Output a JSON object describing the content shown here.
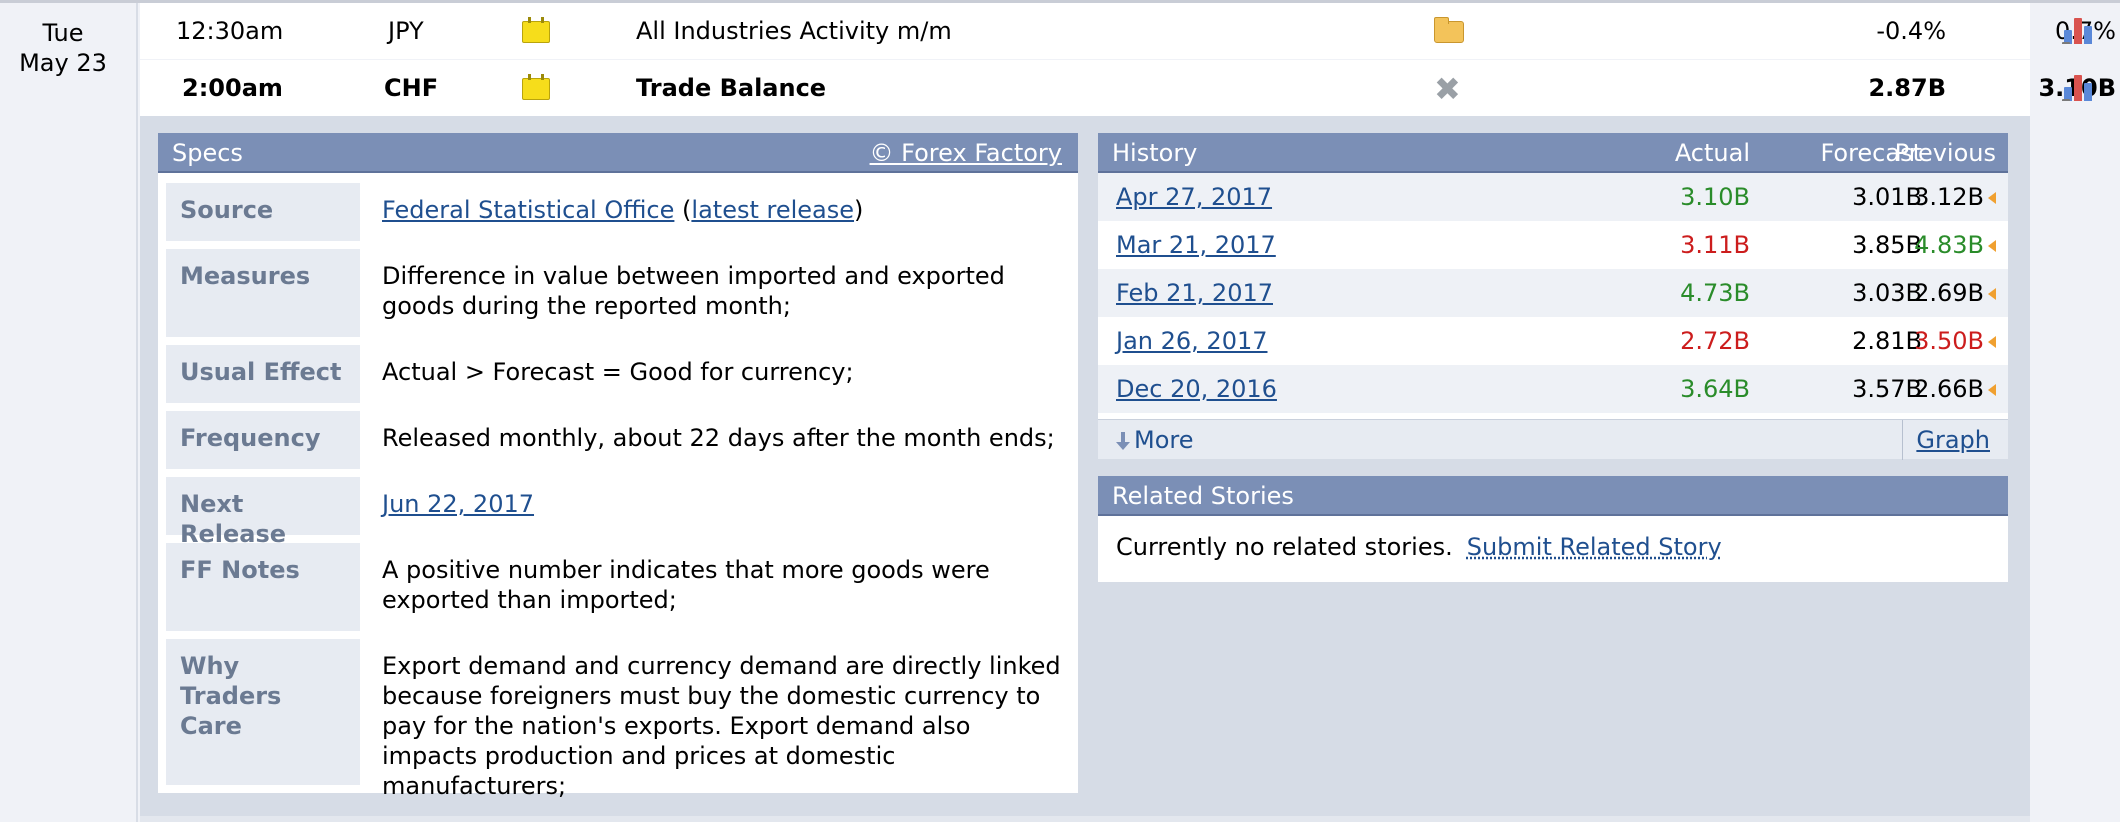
{
  "day": {
    "weekday": "Tue",
    "date": "May 23"
  },
  "events": [
    {
      "time": "12:30am",
      "currency": "JPY",
      "impact_icon": "impact-yellow-icon",
      "title": "All Industries Activity m/m",
      "detail_icon": "folder-icon",
      "actual": "-0.4%",
      "forecast": "0.7%",
      "previous": ""
    },
    {
      "time": "2:00am",
      "currency": "CHF",
      "impact_icon": "impact-yellow-icon",
      "title": "Trade Balance",
      "detail_icon": "close-icon",
      "actual": "2.87B",
      "forecast": "3.10B",
      "previous": ""
    }
  ],
  "specs": {
    "header": "Specs",
    "credit": "© Forex Factory",
    "rows": [
      {
        "label": "Source",
        "value_link": "Federal Statistical Office",
        "value_open": " (",
        "value_link2": "latest release",
        "value_close": ")"
      },
      {
        "label": "Measures",
        "value": "Difference in value between imported and exported goods during the reported month;"
      },
      {
        "label": "Usual Effect",
        "value": "Actual > Forecast = Good for currency;"
      },
      {
        "label": "Frequency",
        "value": "Released monthly, about 22 days after the month ends;"
      },
      {
        "label": "Next Release",
        "value_link": "Jun 22, 2017"
      },
      {
        "label": "FF Notes",
        "value": "A positive number indicates that more goods were exported than imported;"
      },
      {
        "label": "Why Traders Care",
        "value": "Export demand and currency demand are directly linked because foreigners must buy the domestic currency to pay for the nation's exports. Export demand also impacts production and prices at domestic manufacturers;"
      }
    ]
  },
  "history": {
    "header": "History",
    "col_actual": "Actual",
    "col_forecast": "Forecast",
    "col_previous": "Previous",
    "rows": [
      {
        "date": "Apr 27, 2017",
        "actual": "3.10B",
        "actual_color": "green",
        "forecast": "3.01B",
        "previous": "3.12B",
        "previous_color": "black"
      },
      {
        "date": "Mar 21, 2017",
        "actual": "3.11B",
        "actual_color": "red",
        "forecast": "3.85B",
        "previous": "4.83B",
        "previous_color": "green"
      },
      {
        "date": "Feb 21, 2017",
        "actual": "4.73B",
        "actual_color": "green",
        "forecast": "3.03B",
        "previous": "2.69B",
        "previous_color": "black"
      },
      {
        "date": "Jan 26, 2017",
        "actual": "2.72B",
        "actual_color": "red",
        "forecast": "2.81B",
        "previous": "3.50B",
        "previous_color": "red"
      },
      {
        "date": "Dec 20, 2016",
        "actual": "3.64B",
        "actual_color": "green",
        "forecast": "3.57B",
        "previous": "2.66B",
        "previous_color": "black"
      }
    ],
    "more_label": "More",
    "graph_label": "Graph"
  },
  "related": {
    "header": "Related Stories",
    "empty_text": "Currently no related stories.",
    "submit_label": "Submit Related Story"
  },
  "colors": {
    "header_bg": "#7b8fb6",
    "green": "#2a8c2a",
    "red": "#cc1d1d",
    "link": "#1f4f8f",
    "impact_yellow": "#f6dd1b"
  }
}
